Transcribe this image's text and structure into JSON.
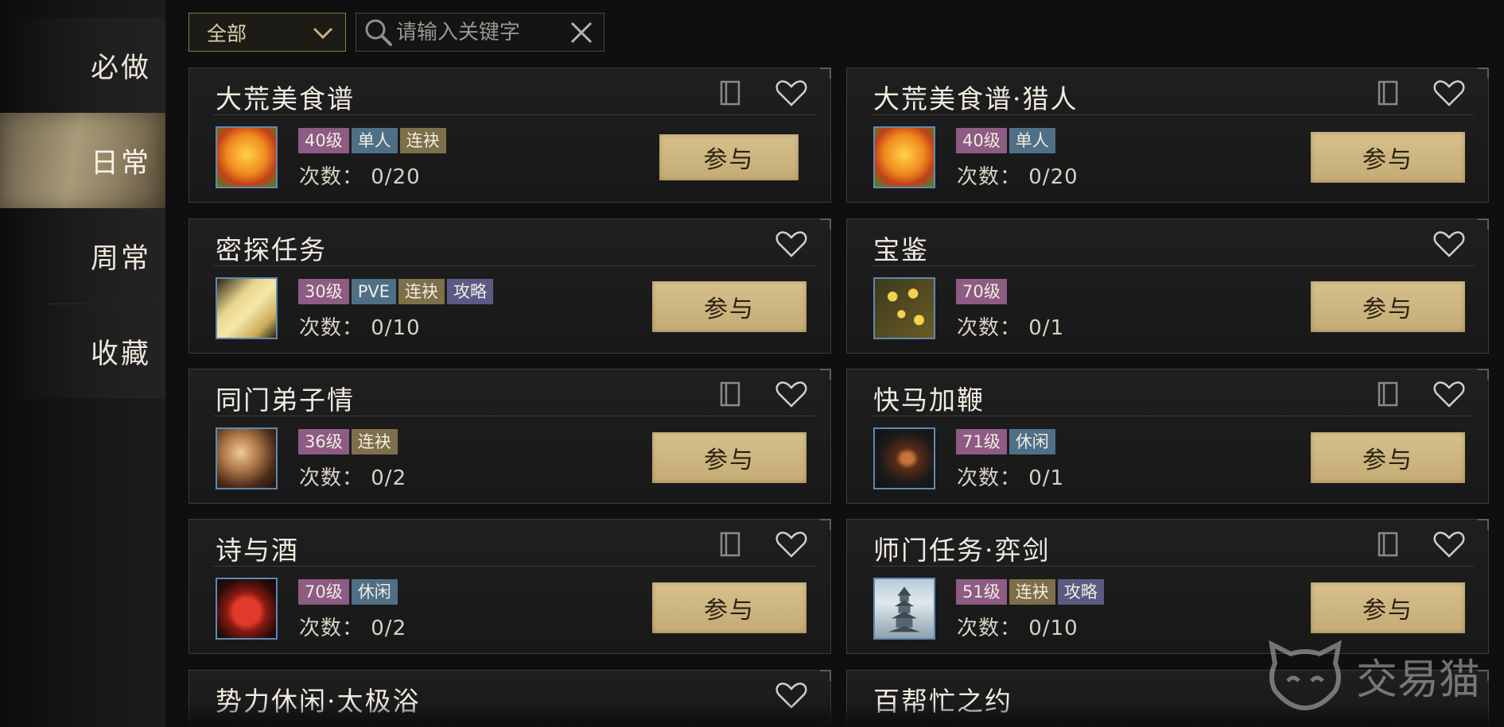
{
  "sidebar": {
    "items": [
      {
        "label": "必做"
      },
      {
        "label": "日常"
      },
      {
        "label": "周常"
      },
      {
        "label": "收藏"
      }
    ]
  },
  "filter": {
    "selected": "全部"
  },
  "search": {
    "placeholder": "请输入关键字",
    "value": ""
  },
  "colors": {
    "accent_gold": "#c9b27c",
    "level_tag": "#8d5b84",
    "type_tag": "#4f6f87",
    "chain_tag": "#7d6f49",
    "guide_tag": "#5a5a85"
  },
  "cards": [
    {
      "title": "大荒美食谱",
      "tags": [
        "40级",
        "单人",
        "连袂"
      ],
      "count": "次数： 0/20",
      "button": "参与",
      "icon": "food-dish-icon"
    },
    {
      "title": "大荒美食谱·猎人",
      "tags": [
        "40级",
        "单人"
      ],
      "count": "次数： 0/20",
      "button": "参与",
      "icon": "food-dish-icon"
    },
    {
      "title": "密探任务",
      "tags": [
        "30级",
        "PVE",
        "连袂",
        "攻略"
      ],
      "count": "次数： 0/10",
      "button": "参与",
      "icon": "scroll-icon"
    },
    {
      "title": "宝鉴",
      "tags": [
        "70级"
      ],
      "count": "次数： 0/1",
      "button": "参与",
      "icon": "gold-coins-icon"
    },
    {
      "title": "同门弟子情",
      "tags": [
        "36级",
        "连袂"
      ],
      "count": "次数： 0/2",
      "button": "参与",
      "icon": "portrait-icon"
    },
    {
      "title": "快马加鞭",
      "tags": [
        "71级",
        "休闲"
      ],
      "count": "次数： 0/1",
      "button": "参与",
      "icon": "whip-icon"
    },
    {
      "title": "诗与酒",
      "tags": [
        "70级",
        "休闲"
      ],
      "count": "次数： 0/2",
      "button": "参与",
      "icon": "wine-jar-icon"
    },
    {
      "title": "师门任务·弈剑",
      "tags": [
        "51级",
        "连袂",
        "攻略"
      ],
      "count": "次数： 0/10",
      "button": "参与",
      "icon": "pagoda-icon"
    },
    {
      "title": "势力休闲·太极浴",
      "tags": [],
      "count": "",
      "button": "",
      "icon": ""
    },
    {
      "title": "百帮忙之约",
      "tags": [],
      "count": "",
      "button": "",
      "icon": ""
    }
  ],
  "watermark": {
    "text": "交易猫"
  }
}
